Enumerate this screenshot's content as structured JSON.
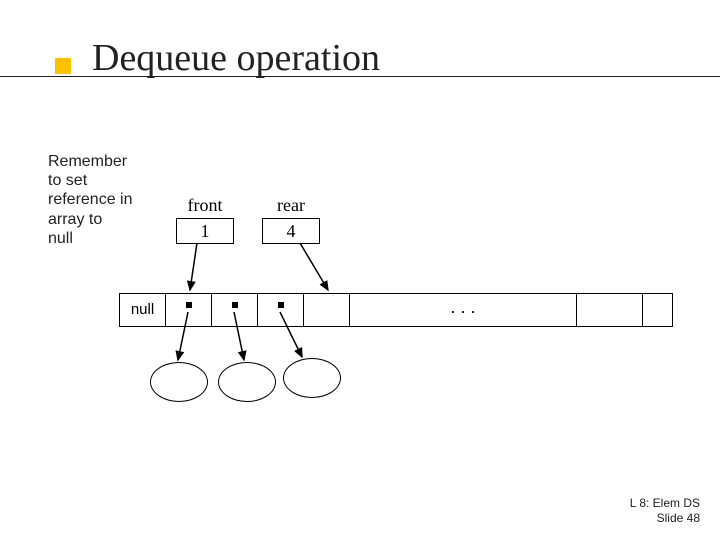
{
  "title": "Dequeue operation",
  "note_lines": [
    "Remember",
    "to set",
    "reference in",
    "array to",
    "null"
  ],
  "front": {
    "label": "front",
    "value": "1"
  },
  "rear": {
    "label": "rear",
    "value": "4"
  },
  "array": {
    "null_label": "null",
    "ellipsis": ". . ."
  },
  "footer": {
    "line1": "L 8: Elem DS",
    "line2": "Slide 48"
  }
}
